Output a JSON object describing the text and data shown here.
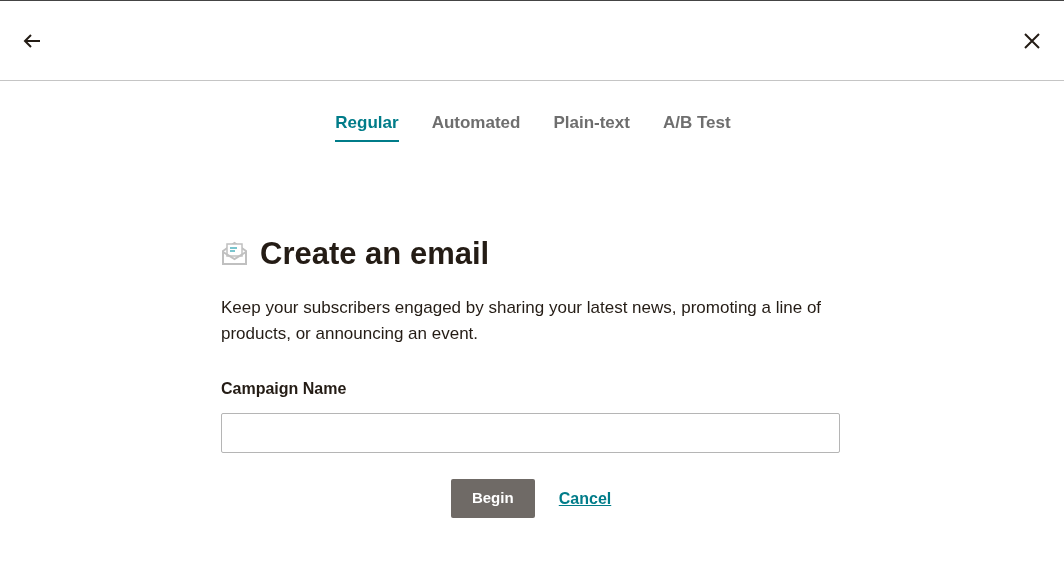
{
  "tabs": [
    {
      "label": "Regular",
      "selected": true
    },
    {
      "label": "Automated",
      "selected": false
    },
    {
      "label": "Plain-text",
      "selected": false
    },
    {
      "label": "A/B Test",
      "selected": false
    }
  ],
  "heading": "Create an email",
  "description": "Keep your subscribers engaged by sharing your latest news, promoting a line of products, or announcing an event.",
  "field": {
    "label": "Campaign Name"
  },
  "buttons": {
    "primary": "Begin",
    "cancel": "Cancel"
  }
}
